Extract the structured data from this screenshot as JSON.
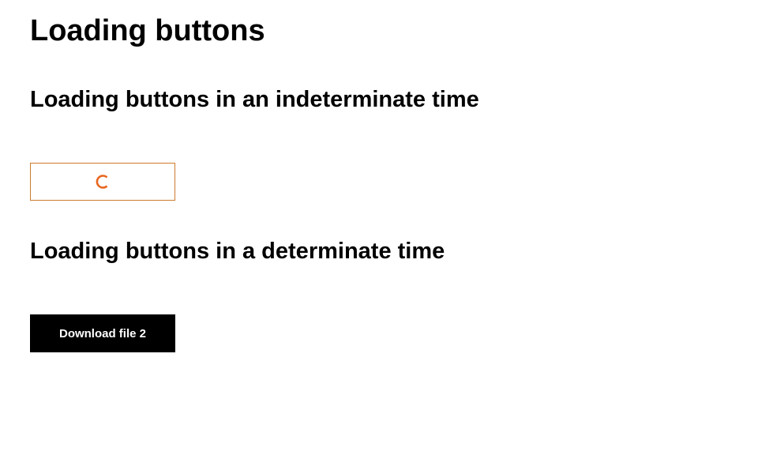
{
  "page": {
    "title": "Loading buttons"
  },
  "sections": {
    "indeterminate": {
      "heading": "Loading buttons in an indeterminate time",
      "button": {
        "state": "loading",
        "spinner_icon": "spinner-icon",
        "accent_color": "#e8661e",
        "border_color": "#cc7a2c"
      }
    },
    "determinate": {
      "heading": "Loading buttons in a determinate time",
      "button": {
        "label": "Download file 2",
        "background": "#000000",
        "text_color": "#ffffff"
      }
    }
  }
}
